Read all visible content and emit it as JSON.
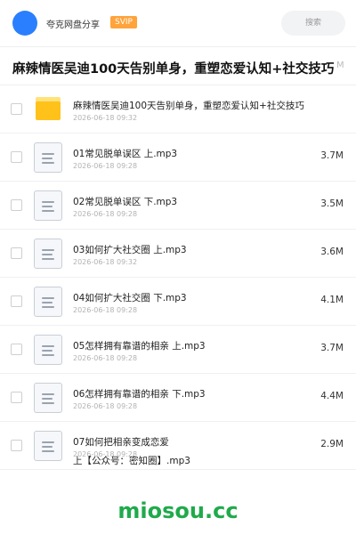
{
  "header": {
    "username": "夸克网盘分享",
    "badge": "SVIP",
    "search_placeholder": "搜索"
  },
  "page_title": "麻辣情医吴迪100天告别单身，重塑恋爱认知+社交技巧",
  "title_overflow": "M",
  "folder": {
    "name": "麻辣情医吴迪100天告别单身，重塑恋爱认知+社交技巧",
    "date": "2026-06-18 09:32"
  },
  "files": [
    {
      "name": "01常见脱单误区 上.mp3",
      "date": "2026-06-18 09:28",
      "size": "3.7M"
    },
    {
      "name": "02常见脱单误区 下.mp3",
      "date": "2026-06-18 09:28",
      "size": "3.5M"
    },
    {
      "name": "03如何扩大社交圈 上.mp3",
      "date": "2026-06-18 09:32",
      "size": "3.6M"
    },
    {
      "name": "04如何扩大社交圈 下.mp3",
      "date": "2026-06-18 09:28",
      "size": "4.1M"
    },
    {
      "name": "05怎样拥有靠谱的相亲 上.mp3",
      "date": "2026-06-18 09:28",
      "size": "3.7M"
    },
    {
      "name": "06怎样拥有靠谱的相亲 下.mp3",
      "date": "2026-06-18 09:28",
      "size": "4.4M"
    }
  ],
  "last_file": {
    "name_line1": "07如何把相亲变成恋爱",
    "name_line2": "上【公众号：密知圈】.mp3",
    "date": "2026-06-18 09:28",
    "size": "2.9M"
  },
  "watermark": "miosou.cc",
  "colors": {
    "avatar": "#2a7fff",
    "svip_badge": "#ffa33a",
    "folder": "#ffc21a",
    "watermark": "#1faa4b"
  }
}
